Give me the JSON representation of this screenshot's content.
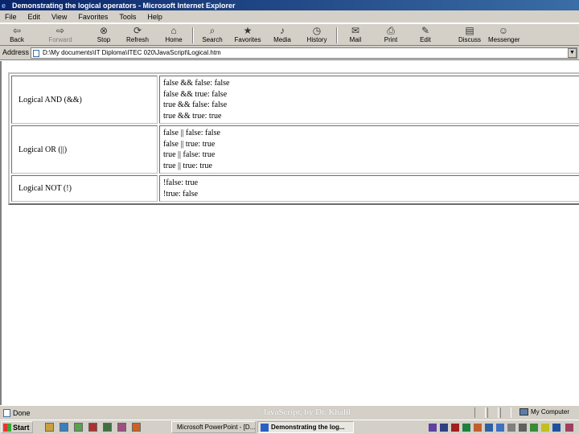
{
  "window": {
    "title": "Demonstrating the logical operators - Microsoft Internet Explorer"
  },
  "menu": [
    "File",
    "Edit",
    "View",
    "Favorites",
    "Tools",
    "Help"
  ],
  "toolbar": {
    "back": "Back",
    "forward": "Forward",
    "stop": "Stop",
    "refresh": "Refresh",
    "home": "Home",
    "search": "Search",
    "favorites": "Favorites",
    "media": "Media",
    "history": "History",
    "mail": "Mail",
    "print": "Print",
    "edit": "Edit",
    "discuss": "Discuss",
    "messenger": "Messenger"
  },
  "address": {
    "label": "Address",
    "value": "D:\\My documents\\IT Diploma\\ITEC 020\\JavaScript\\Logical.htm"
  },
  "table": {
    "rows": [
      {
        "operator": "Logical AND (&&)",
        "lines": [
          "false && false: false",
          "false && true: false",
          "true && false: false",
          "true && true: true"
        ]
      },
      {
        "operator": "Logical OR (||)",
        "lines": [
          "false || false: false",
          "false || true: true",
          "true || false: true",
          "true || true: true"
        ]
      },
      {
        "operator": "Logical NOT (!)",
        "lines": [
          "!false: true",
          "!true: false"
        ]
      }
    ]
  },
  "status": {
    "text": "Done",
    "footer": "JavaScript, by Dr. Khalil",
    "zone": "My Computer"
  },
  "taskbar": {
    "start": "Start",
    "tasks": [
      "Microsoft PowerPoint - [D...",
      "Demonstrating the log..."
    ]
  },
  "colors": {
    "titlebar": "#0a246a",
    "chrome": "#d4d0c8"
  }
}
